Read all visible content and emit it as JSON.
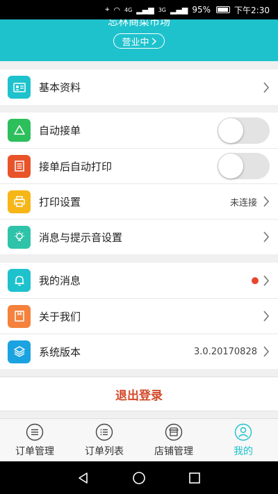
{
  "status_bar": {
    "battery": "95%",
    "time": "下午2:30",
    "net_a": "4G",
    "net_b": "3G"
  },
  "header": {
    "store_name": "忘林商菜市场",
    "status_badge": "营业中"
  },
  "groups": {
    "profile": {
      "label": "基本资料"
    },
    "auto_accept": {
      "label": "自动接单"
    },
    "auto_print": {
      "label": "接单后自动打印"
    },
    "print_settings": {
      "label": "打印设置",
      "value": "未连接"
    },
    "notify_settings": {
      "label": "消息与提示音设置"
    },
    "my_messages": {
      "label": "我的消息"
    },
    "about": {
      "label": "关于我们"
    },
    "version": {
      "label": "系统版本",
      "value": "3.0.20170828"
    }
  },
  "logout": {
    "label": "退出登录"
  },
  "tabs": [
    {
      "label": "订单管理"
    },
    {
      "label": "订单列表"
    },
    {
      "label": "店铺管理"
    },
    {
      "label": "我的"
    }
  ],
  "colors": {
    "accent": "#1ec2cd",
    "logout": "#d24a2a",
    "badge_dot": "#e8452f"
  }
}
